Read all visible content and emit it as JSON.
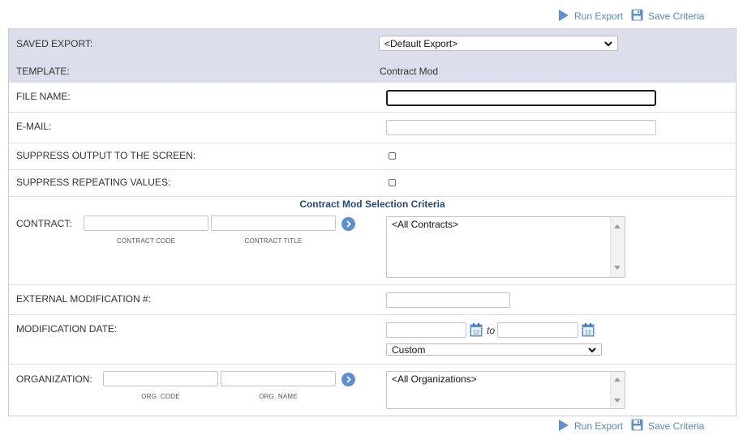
{
  "toolbar": {
    "run_export_label": "Run Export",
    "save_criteria_label": "Save Criteria"
  },
  "saved_export": {
    "label": "SAVED EXPORT:",
    "selected": "<Default Export>"
  },
  "template": {
    "label": "TEMPLATE:",
    "value": "Contract Mod"
  },
  "file_name": {
    "label": "FILE NAME:",
    "value": ""
  },
  "email": {
    "label": "E-MAIL:",
    "value": ""
  },
  "suppress_output": {
    "label": "SUPPRESS OUTPUT TO THE SCREEN:",
    "checked": false
  },
  "suppress_repeating": {
    "label": "SUPPRESS REPEATING VALUES:",
    "checked": false
  },
  "section_title": "Contract Mod Selection Criteria",
  "contract": {
    "label": "CONTRACT:",
    "code_sublabel": "CONTRACT CODE",
    "title_sublabel": "CONTRACT TITLE",
    "list_items": [
      "<All Contracts>"
    ]
  },
  "external_mod": {
    "label": "EXTERNAL MODIFICATION #:",
    "value": ""
  },
  "mod_date": {
    "label": "MODIFICATION DATE:",
    "to_label": "to",
    "range_selected": "Custom"
  },
  "organization": {
    "label": "ORGANIZATION:",
    "code_sublabel": "ORG. CODE",
    "name_sublabel": "ORG. NAME",
    "list_items": [
      "<All Organizations>"
    ]
  },
  "colors": {
    "link": "#5a86c5",
    "header_row_bg": "#dcdeec",
    "section_title": "#24487a",
    "go_button": "#5b8fd4"
  },
  "icons": {
    "run": "play-triangle-icon",
    "save": "floppy-disk-icon",
    "go": "chevron-right-circle-icon",
    "calendar": "calendar-icon"
  }
}
